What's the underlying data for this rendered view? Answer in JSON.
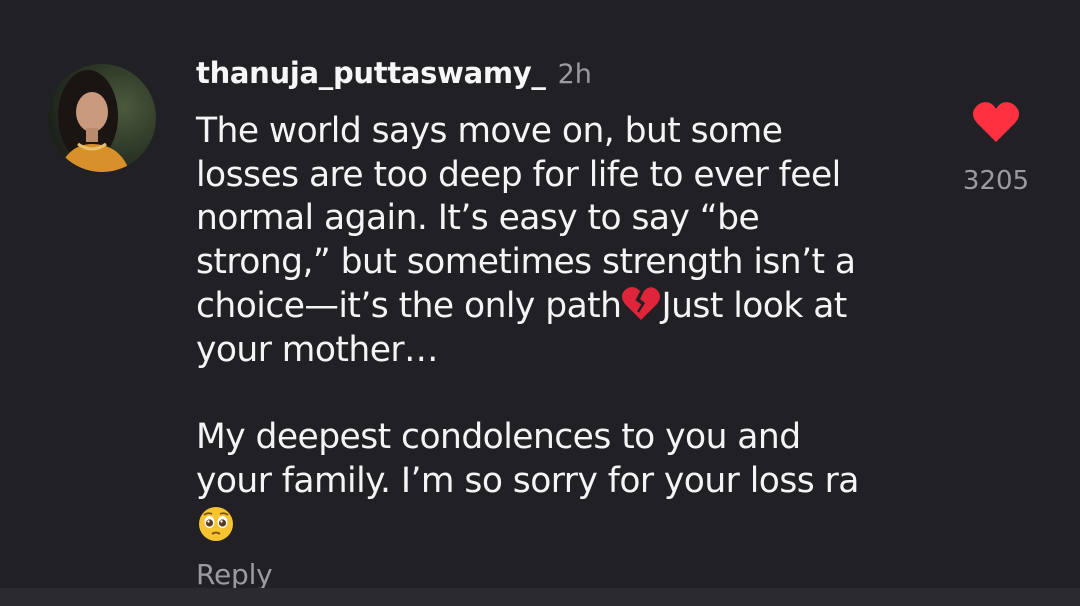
{
  "comment": {
    "username": "thanuja_puttaswamy_",
    "time": "2h",
    "text_lines_p1": [
      "The world says move on, but some",
      "losses are too deep for life to ever feel",
      "normal again. It’s easy to say “be",
      "strong,” but sometimes strength isn’t a"
    ],
    "line5_before_emoji": "choice—it’s the only path",
    "line5_after_emoji": "Just look at",
    "line6": "your mother…",
    "text_lines_p2": [
      "My deepest condolences to you and",
      "your family. I’m so sorry for your loss ra"
    ],
    "emoji_broken_heart": "broken-heart-emoji",
    "emoji_pleading": "pleading-face-emoji",
    "reply_label": "Reply",
    "like_count": "3205",
    "like_icon": "heart-icon",
    "like_color": "#ff3040"
  }
}
